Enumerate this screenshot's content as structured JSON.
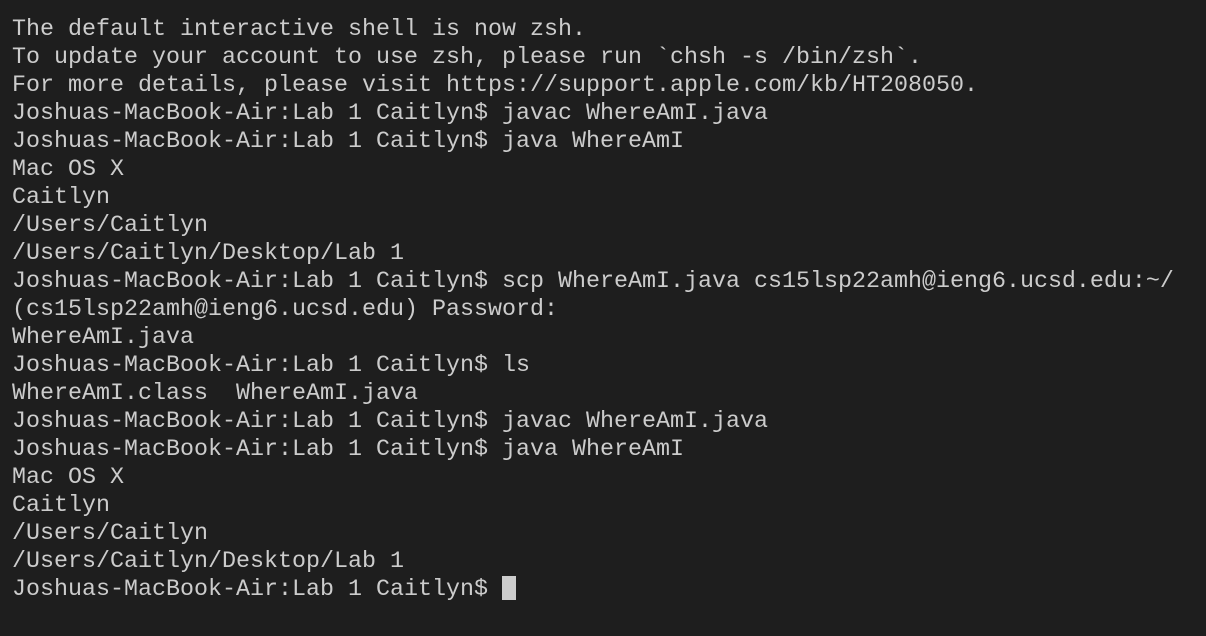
{
  "terminal": {
    "lines": [
      "The default interactive shell is now zsh.",
      "To update your account to use zsh, please run `chsh -s /bin/zsh`.",
      "For more details, please visit https://support.apple.com/kb/HT208050.",
      "Joshuas-MacBook-Air:Lab 1 Caitlyn$ javac WhereAmI.java",
      "Joshuas-MacBook-Air:Lab 1 Caitlyn$ java WhereAmI",
      "Mac OS X",
      "Caitlyn",
      "/Users/Caitlyn",
      "/Users/Caitlyn/Desktop/Lab 1",
      "Joshuas-MacBook-Air:Lab 1 Caitlyn$ scp WhereAmI.java cs15lsp22amh@ieng6.ucsd.edu:~/",
      "(cs15lsp22amh@ieng6.ucsd.edu) Password:",
      "WhereAmI.java",
      "Joshuas-MacBook-Air:Lab 1 Caitlyn$ ls",
      "WhereAmI.class  WhereAmI.java",
      "Joshuas-MacBook-Air:Lab 1 Caitlyn$ javac WhereAmI.java",
      "Joshuas-MacBook-Air:Lab 1 Caitlyn$ java WhereAmI",
      "Mac OS X",
      "Caitlyn",
      "/Users/Caitlyn",
      "/Users/Caitlyn/Desktop/Lab 1"
    ],
    "prompt": "Joshuas-MacBook-Air:Lab 1 Caitlyn$ "
  }
}
